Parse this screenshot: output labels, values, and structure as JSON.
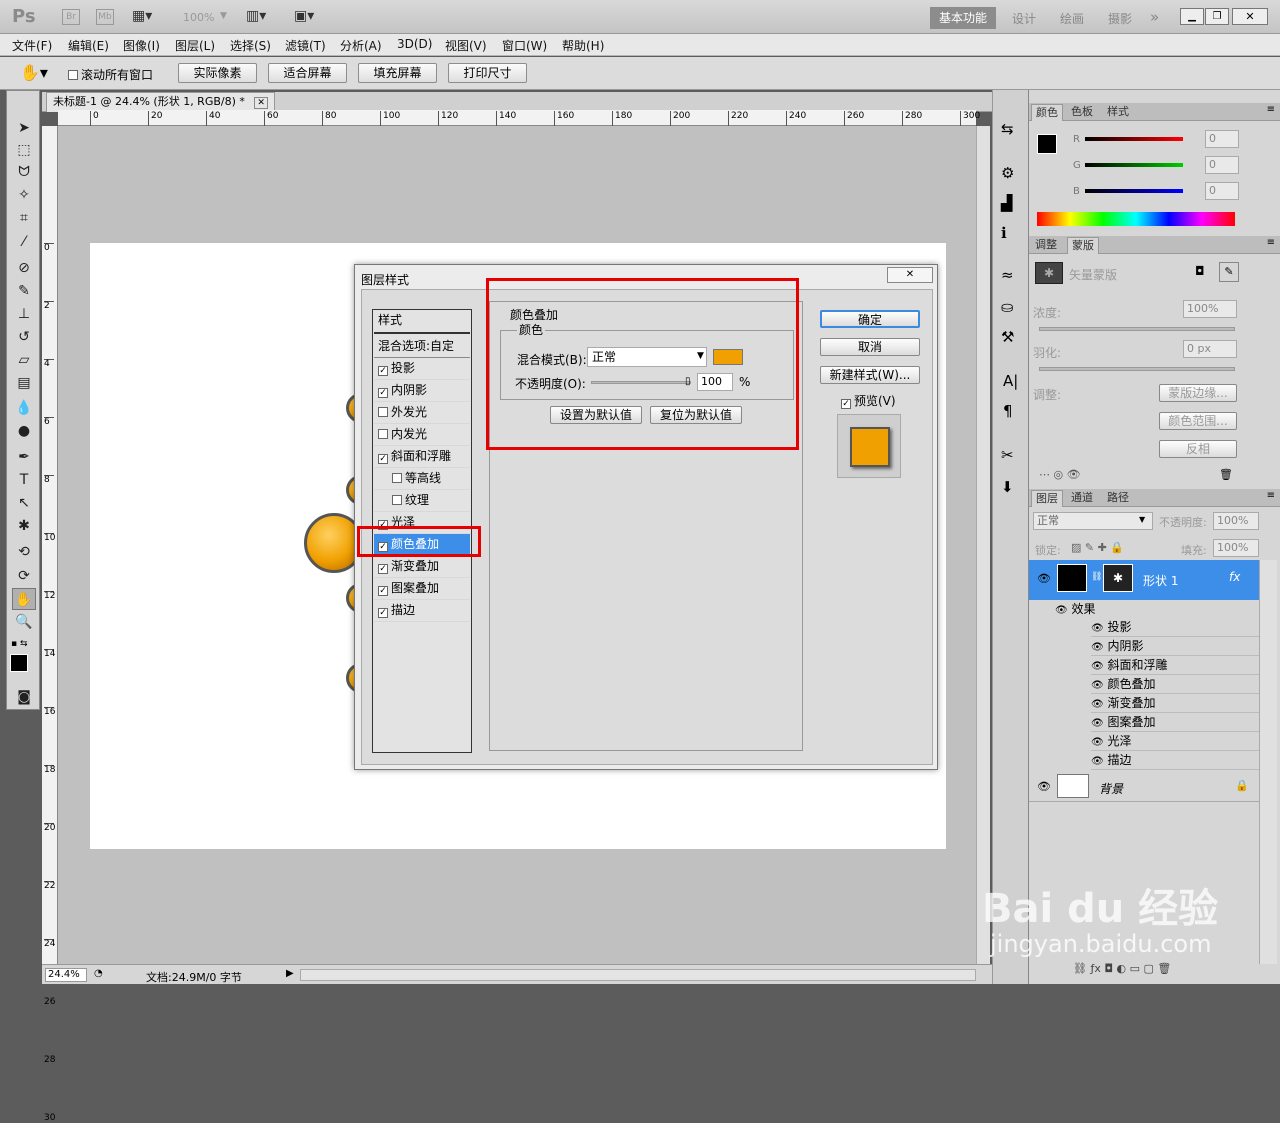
{
  "app": {
    "logo": "Ps",
    "launch_icons": [
      "Br",
      "Mb"
    ],
    "zoom_select": "100%",
    "workspaces": [
      "基本功能",
      "设计",
      "绘画",
      "摄影"
    ],
    "workspace_more": "»"
  },
  "menu": [
    "文件(F)",
    "编辑(E)",
    "图像(I)",
    "图层(L)",
    "选择(S)",
    "滤镜(T)",
    "分析(A)",
    "3D(D)",
    "视图(V)",
    "窗口(W)",
    "帮助(H)"
  ],
  "options": {
    "scroll_all_label": "滚动所有窗口",
    "buttons": [
      "实际像素",
      "适合屏幕",
      "填充屏幕",
      "打印尺寸"
    ]
  },
  "document": {
    "tab_title": "未标题-1 @ 24.4% (形状 1, RGB/8) *",
    "ruler_top": [
      "0",
      "20",
      "40",
      "60",
      "80",
      "100",
      "120",
      "140",
      "160",
      "180",
      "200",
      "220",
      "240",
      "260",
      "280",
      "300"
    ],
    "ruler_left": [
      "0",
      "2",
      "4",
      "6",
      "8",
      "10",
      "12",
      "14",
      "16",
      "18",
      "20",
      "22",
      "24",
      "26",
      "28",
      "30"
    ],
    "zoom": "24.4%",
    "doc_info": "文档:24.9M/0 字节"
  },
  "dialog": {
    "title": "图层样式",
    "styles_header": "样式",
    "blend_options": "混合选项:自定",
    "styles": [
      {
        "label": "投影",
        "checked": true
      },
      {
        "label": "内阴影",
        "checked": true
      },
      {
        "label": "外发光",
        "checked": false
      },
      {
        "label": "内发光",
        "checked": false
      },
      {
        "label": "斜面和浮雕",
        "checked": true
      },
      {
        "label": "等高线",
        "checked": false
      },
      {
        "label": "纹理",
        "checked": false
      },
      {
        "label": "光泽",
        "checked": true
      },
      {
        "label": "颜色叠加",
        "checked": true
      },
      {
        "label": "渐变叠加",
        "checked": true
      },
      {
        "label": "图案叠加",
        "checked": true
      },
      {
        "label": "描边",
        "checked": true
      }
    ],
    "section_title": "颜色叠加",
    "group_title": "颜色",
    "blend_mode_label": "混合模式(B):",
    "blend_mode_value": "正常",
    "overlay_color": "#f0a000",
    "opacity_label": "不透明度(O):",
    "opacity_value": "100",
    "opacity_unit": "%",
    "set_default": "设置为默认值",
    "reset_default": "复位为默认值",
    "ok": "确定",
    "cancel": "取消",
    "new_style": "新建样式(W)...",
    "preview_label": "预览(V)"
  },
  "color_panel": {
    "tabs": [
      "颜色",
      "色板",
      "样式"
    ],
    "channels": [
      {
        "label": "R",
        "value": "0"
      },
      {
        "label": "G",
        "value": "0"
      },
      {
        "label": "B",
        "value": "0"
      }
    ]
  },
  "mask_panel": {
    "tabs": [
      "调整",
      "蒙版"
    ],
    "vector_mask": "矢量蒙版",
    "density_label": "浓度:",
    "density_value": "100%",
    "feather_label": "羽化:",
    "feather_value": "0 px",
    "adjust_label": "调整:",
    "buttons": [
      "蒙版边缘...",
      "颜色范围...",
      "反相"
    ]
  },
  "layers_panel": {
    "tabs": [
      "图层",
      "通道",
      "路径"
    ],
    "blend_mode": "正常",
    "opacity_label": "不透明度:",
    "opacity_value": "100%",
    "lock_label": "锁定:",
    "fill_label": "填充:",
    "fill_value": "100%",
    "shape_layer": "形状 1",
    "effects_label": "效果",
    "effects": [
      "投影",
      "内阴影",
      "斜面和浮雕",
      "颜色叠加",
      "渐变叠加",
      "图案叠加",
      "光泽",
      "描边"
    ],
    "background_layer": "背景"
  },
  "watermark": {
    "brand": "Bai du 经验",
    "url": "jingyan.baidu.com"
  }
}
